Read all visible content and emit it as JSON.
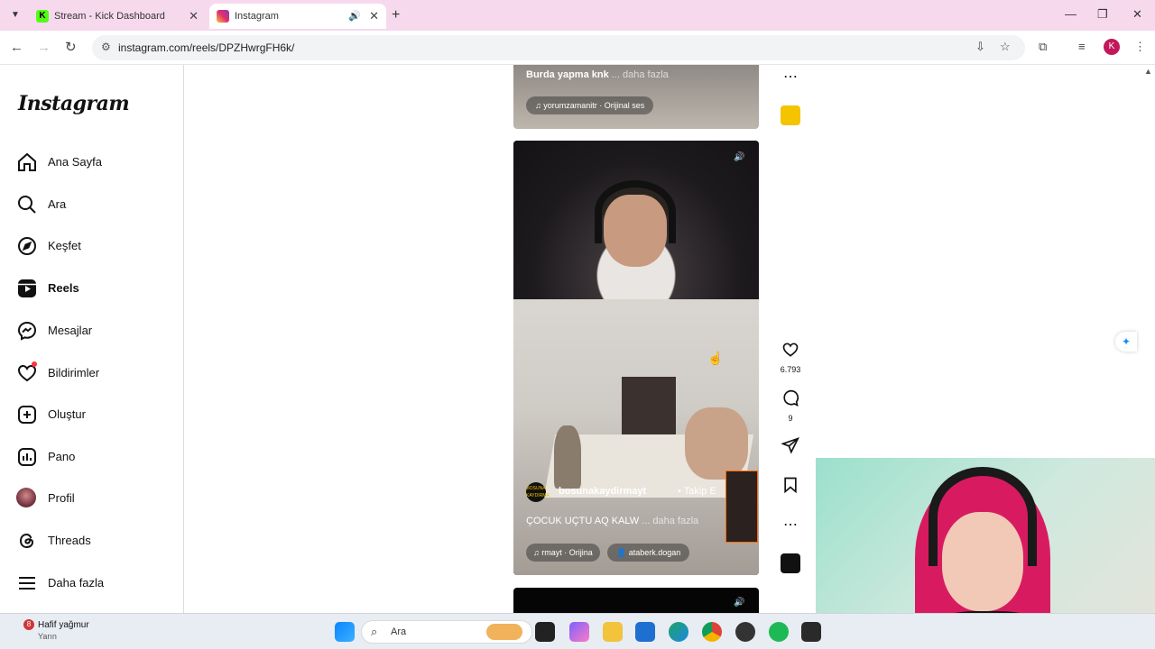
{
  "browser": {
    "tabs": [
      {
        "title": "Stream - Kick Dashboard",
        "favicon": "kick-icon"
      },
      {
        "title": "Instagram",
        "favicon": "instagram-icon",
        "active": true
      }
    ],
    "url": "instagram.com/reels/DPZHwrgFH6k/",
    "profile_initial": "K"
  },
  "sidebar": {
    "logo": "Instagram",
    "items": [
      {
        "label": "Ana Sayfa",
        "icon": "home-icon"
      },
      {
        "label": "Ara",
        "icon": "search-icon"
      },
      {
        "label": "Keşfet",
        "icon": "compass-icon"
      },
      {
        "label": "Reels",
        "icon": "reels-icon",
        "active": true
      },
      {
        "label": "Mesajlar",
        "icon": "messenger-icon"
      },
      {
        "label": "Bildirimler",
        "icon": "heart-icon"
      },
      {
        "label": "Oluştur",
        "icon": "plus-icon"
      },
      {
        "label": "Pano",
        "icon": "dashboard-icon"
      },
      {
        "label": "Profil",
        "icon": "avatar-icon"
      },
      {
        "label": "Threads",
        "icon": "threads-icon"
      },
      {
        "label": "Daha fazla",
        "icon": "menu-icon"
      }
    ]
  },
  "reel_prev": {
    "caption": "Burda yapma knk",
    "more": "... daha fazla",
    "audio": "yorumzamanitr · Orijinal ses"
  },
  "reel_current": {
    "username": "bosunakaydirmayt",
    "separator": "•",
    "follow": "Takip E",
    "caption": "ÇOCUK UÇTU AQ KALW",
    "more": "... daha fazla",
    "audio": "rmayt · Orijina",
    "collab": "ataberk.dogan",
    "avatar_text": "BOSUNA KAYDIRMA",
    "likes": "6.793",
    "comments": "9"
  },
  "taskbar": {
    "weather_title": "Hafif yağmur",
    "weather_sub": "Yarın",
    "weather_badge": "8",
    "search_label": "Ara"
  },
  "colors": {
    "tabbar": "#f7d9ee",
    "notification_dot": "#ff3040"
  }
}
